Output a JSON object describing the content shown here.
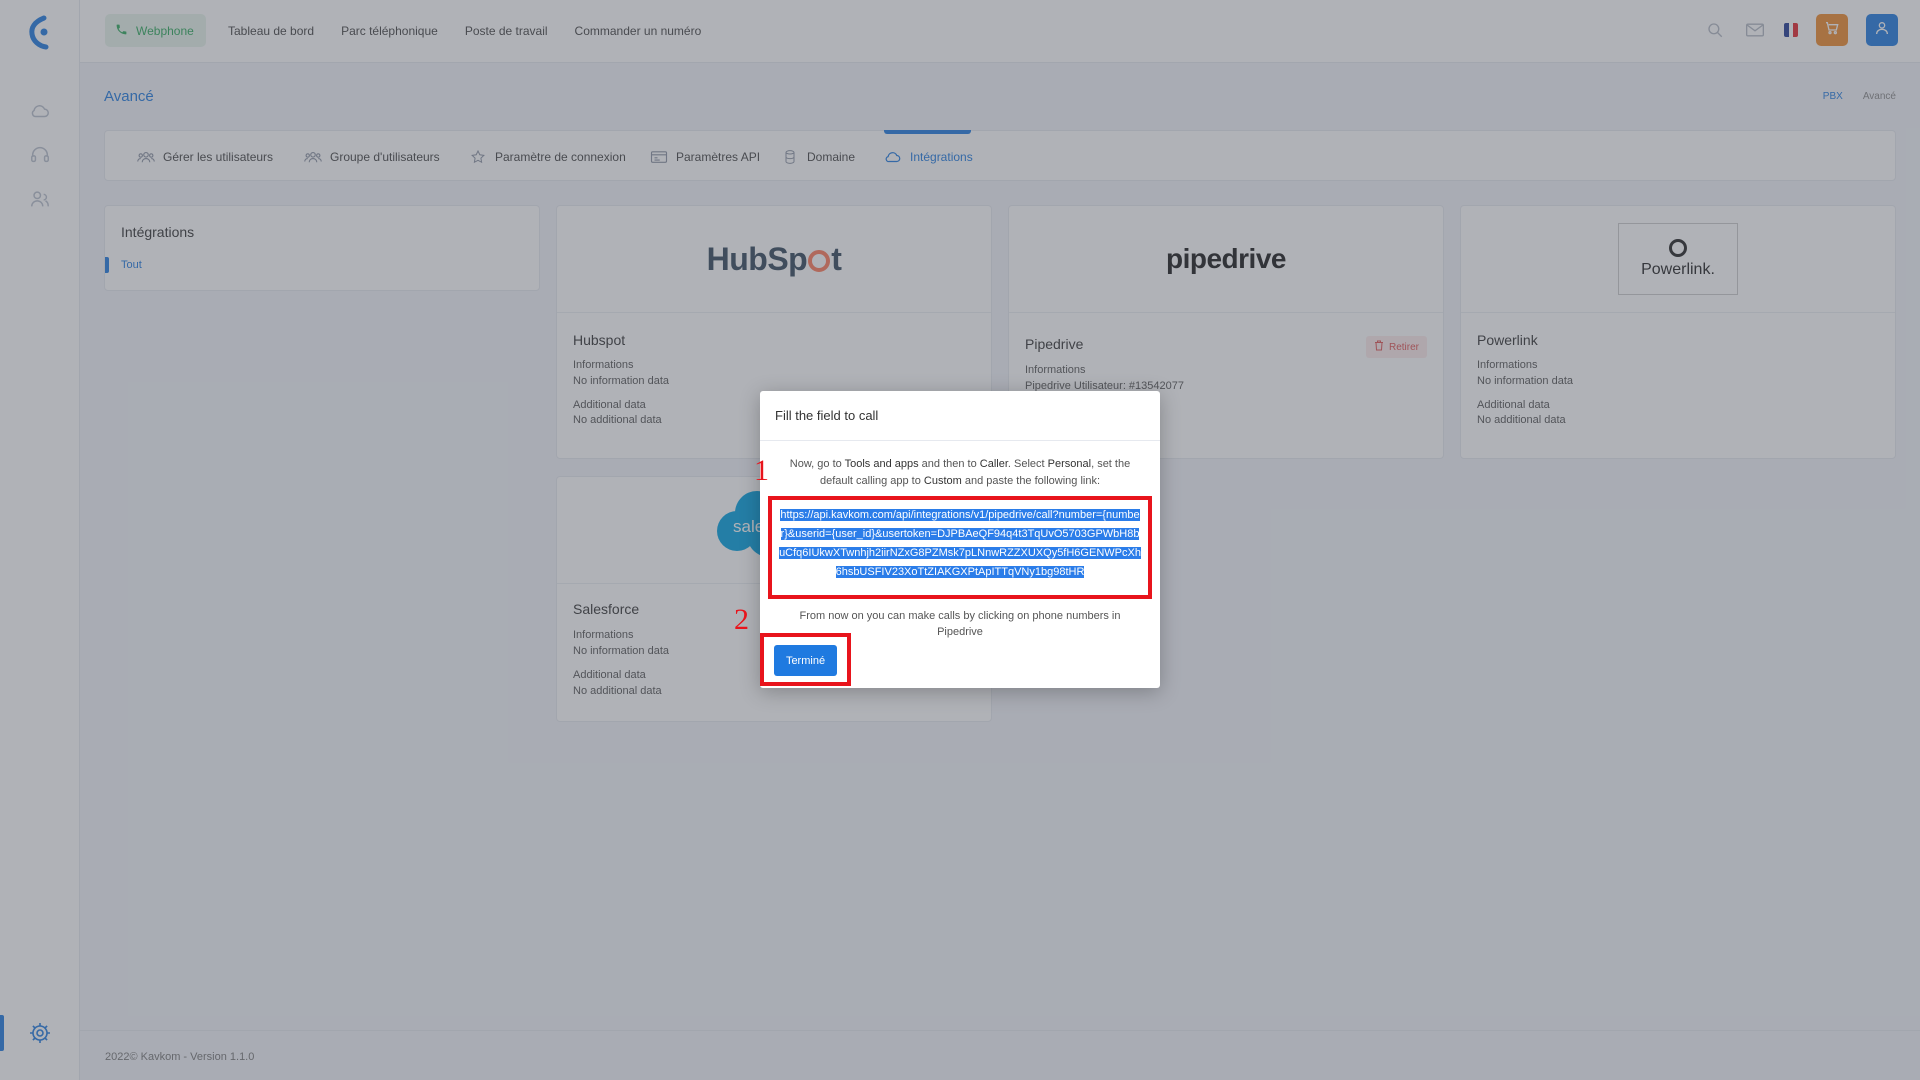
{
  "topbar": {
    "webphone_label": "Webphone",
    "nav": [
      "Tableau de bord",
      "Parc téléphonique",
      "Poste de travail",
      "Commander un numéro"
    ],
    "flag_colors": [
      "#1f3a93",
      "#ffffff",
      "#e3262c"
    ],
    "cart_color": "#ef8a2c",
    "user_color": "#1f7ae0"
  },
  "page": {
    "title": "Avancé",
    "breadcrumb": [
      "PBX",
      "Avancé"
    ]
  },
  "tabs": [
    {
      "label": "Gérer les utilisateurs",
      "icon": "users-icon"
    },
    {
      "label": "Groupe d'utilisateurs",
      "icon": "user-group-icon"
    },
    {
      "label": "Paramètre de connexion",
      "icon": "star-icon"
    },
    {
      "label": "Paramètres API",
      "icon": "api-icon"
    },
    {
      "label": "Domaine",
      "icon": "database-icon"
    },
    {
      "label": "Intégrations",
      "icon": "cloud-icon",
      "active": true
    }
  ],
  "filter": {
    "title": "Intégrations",
    "items": [
      "Tout"
    ]
  },
  "cards": {
    "hubspot": {
      "logo_text_a": "HubSp",
      "logo_text_b": "t",
      "name": "Hubspot",
      "info_label": "Informations",
      "info_value": "No information data",
      "add_label": "Additional data",
      "add_value": "No additional data"
    },
    "pipedrive": {
      "logo_text": "pipedrive",
      "name": "Pipedrive",
      "retirer": "Retirer",
      "info_label": "Informations",
      "info_value": "Pipedrive Utilisateur: #13542077"
    },
    "powerlink": {
      "logo_text": "Powerlink.",
      "name": "Powerlink",
      "info_label": "Informations",
      "info_value": "No information data",
      "add_label": "Additional data",
      "add_value": "No additional data"
    },
    "salesforce": {
      "logo_text": "sale",
      "name": "Salesforce",
      "info_label": "Informations",
      "info_value": "No information data",
      "add_label": "Additional data",
      "add_value": "No additional data"
    }
  },
  "modal": {
    "title": "Fill the field to call",
    "instr_1": "Now, go to ",
    "instr_b1": "Tools and apps",
    "instr_2": " and then to ",
    "instr_b2": "Caller",
    "instr_3": ". Select ",
    "instr_b3": "Personal",
    "instr_4": ", set the default calling app to ",
    "instr_b4": "Custom",
    "instr_5": " and paste the following link:",
    "url": "https://api.kavkom.com/api/integrations/v1/pipedrive/call?number={number}&userid={user_id}&usertoken=DJPBAeQF94q4t3TqUvO5703GPWbH8buCfq6IUkwXTwnhjh2iirNZxG8PZMsk7pLNnwRZZXUXQy5fH6GENWPcXh6hsbUSFIV23XoTtZIAKGXPtApITTqVNy1bg98tHR",
    "step1": "1",
    "step2": "2",
    "after": "From now on you can make calls by clicking on phone numbers in Pipedrive",
    "done_label": "Terminé"
  },
  "footer": {
    "text": "2022© Kavkom - Version 1.1.0"
  }
}
